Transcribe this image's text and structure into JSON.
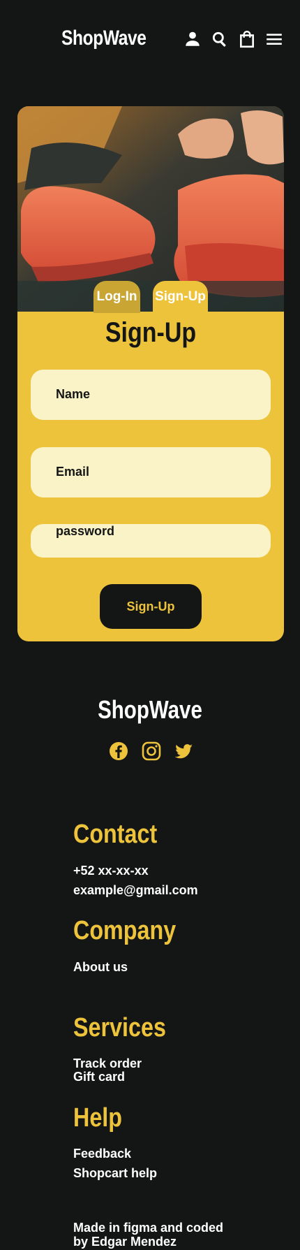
{
  "header": {
    "brand": "ShopWave",
    "icons": [
      "user-icon",
      "search-icon",
      "bag-icon",
      "menu-icon"
    ]
  },
  "auth": {
    "tabs": [
      {
        "label": "Log-In",
        "active": false
      },
      {
        "label": "Sign-Up",
        "active": true
      }
    ],
    "title": "Sign-Up",
    "fields": {
      "name": "Name",
      "email": "Email",
      "password": "password"
    },
    "submit_label": "Sign-Up"
  },
  "footer": {
    "brand": "ShopWave",
    "social_icons": [
      "facebook-icon",
      "instagram-icon",
      "twitter-icon"
    ],
    "sections": [
      {
        "title": "Contact",
        "items": [
          "+52 xx-xx-xx",
          "example@gmail.com"
        ]
      },
      {
        "title": "Company",
        "items": [
          "About us"
        ]
      },
      {
        "title": "Services",
        "items": [
          "Track order",
          "Gift card"
        ]
      },
      {
        "title": "Help",
        "items": [
          "Feedback",
          "Shopcart help"
        ]
      }
    ],
    "credit": "Made in figma and coded by Edgar Mendez"
  },
  "colors": {
    "background": "#141616",
    "accent": "#eec33c",
    "field": "#faf3c8",
    "text_light": "#ffffff"
  }
}
